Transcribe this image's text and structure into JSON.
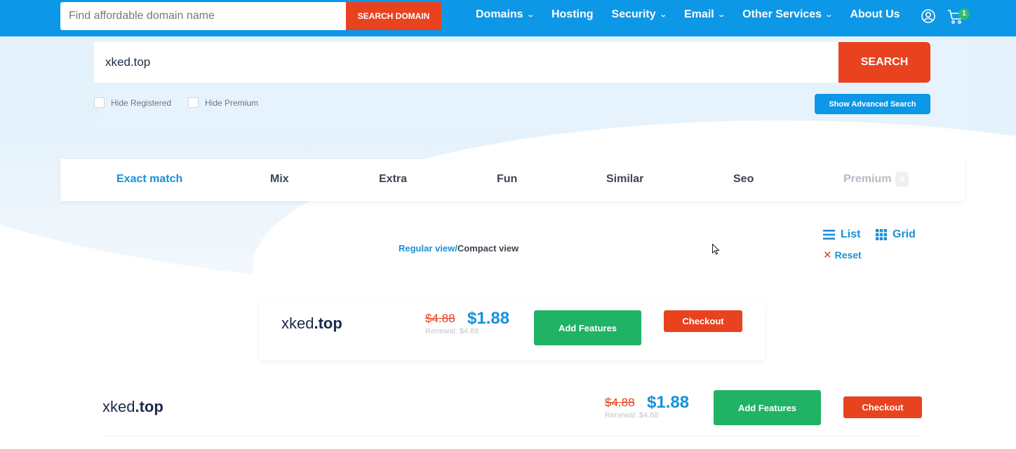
{
  "header": {
    "search_placeholder": "Find affordable domain name",
    "search_button": "SEARCH DOMAIN",
    "nav": [
      {
        "label": "Domains",
        "dropdown": true
      },
      {
        "label": "Hosting",
        "dropdown": false
      },
      {
        "label": "Security",
        "dropdown": true
      },
      {
        "label": "Email",
        "dropdown": true
      },
      {
        "label": "Other Services",
        "dropdown": true
      },
      {
        "label": "About Us",
        "dropdown": false
      }
    ],
    "cart_count": "1",
    "icons": {
      "account": "user-icon",
      "cart": "cart-icon"
    },
    "brand_color": "#0d97e7"
  },
  "search": {
    "value": "xked.top",
    "button": "SEARCH",
    "hide_registered": "Hide Registered",
    "hide_premium": "Hide Premium",
    "advanced_button": "Show Advanced Search"
  },
  "tabs": [
    {
      "label": "Exact match",
      "active": true
    },
    {
      "label": "Mix"
    },
    {
      "label": "Extra"
    },
    {
      "label": "Fun"
    },
    {
      "label": "Similar"
    },
    {
      "label": "Seo"
    },
    {
      "label": "Premium",
      "count": "0"
    }
  ],
  "view": {
    "regular": "Regular view",
    "separator": "/",
    "compact": "Compact view",
    "list": "List",
    "grid": "Grid",
    "reset": "Reset"
  },
  "results": [
    {
      "name": "xked",
      "tld": ".top",
      "old_price": "$4.88",
      "price": "$1.88",
      "renewal": "Renewal: $4.88",
      "features_button": "Add Features",
      "checkout_button": "Checkout"
    },
    {
      "name": "xked",
      "tld": ".top",
      "old_price": "$4.88",
      "price": "$1.88",
      "renewal": "Renewal: $4.88",
      "features_button": "Add Features",
      "checkout_button": "Checkout"
    }
  ],
  "colors": {
    "accent_red": "#e8421f",
    "accent_green": "#20b265",
    "link_blue": "#1891d8"
  }
}
